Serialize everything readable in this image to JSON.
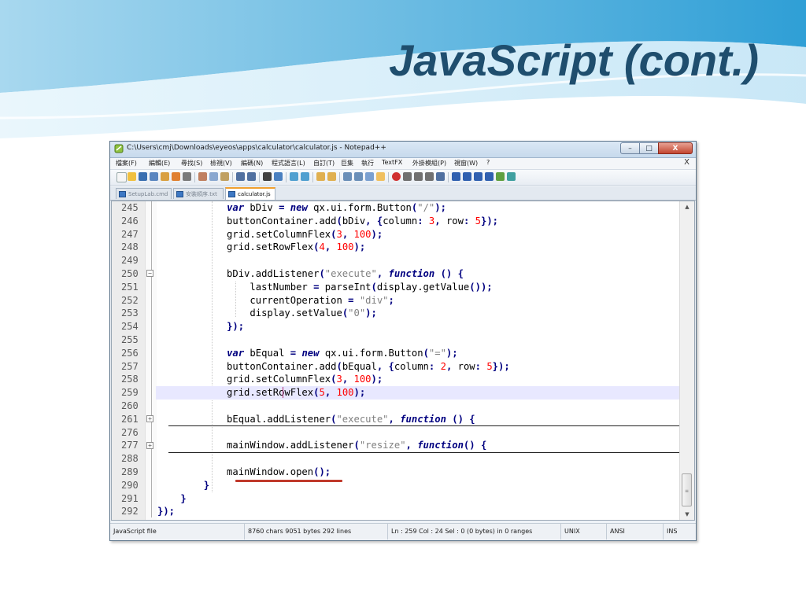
{
  "slide": {
    "title": "JavaScript (cont.)"
  },
  "window": {
    "title": "C:\\Users\\cmj\\Downloads\\eyeos\\apps\\calculator\\calculator.js - Notepad++",
    "min_symbol": "–",
    "max_symbol": "□",
    "close_symbol": "X"
  },
  "menu": {
    "items": [
      "檔案(F)",
      "編輯(E)",
      "尋找(S)",
      "檢視(V)",
      "編碼(N)",
      "程式語言(L)",
      "自訂(T)",
      "巨集",
      "執行",
      "TextFX",
      "外掛模組(P)",
      "視窗(W)",
      "?"
    ],
    "doc_close": "X"
  },
  "tabs": [
    {
      "label": "SetupLab.cmd",
      "active": false
    },
    {
      "label": "安裝順序.txt",
      "active": false
    },
    {
      "label": "calculator.js",
      "active": true
    }
  ],
  "code": {
    "lines": [
      {
        "n": "245",
        "text": "            var bDiv = new qx.ui.form.Button(\"/\");"
      },
      {
        "n": "246",
        "text": "            buttonContainer.add(bDiv, {column: 3, row: 5});"
      },
      {
        "n": "247",
        "text": "            grid.setColumnFlex(3, 100);"
      },
      {
        "n": "248",
        "text": "            grid.setRowFlex(4, 100);"
      },
      {
        "n": "249",
        "text": ""
      },
      {
        "n": "250",
        "text": "            bDiv.addListener(\"execute\", function () {"
      },
      {
        "n": "251",
        "text": "                lastNumber = parseInt(display.getValue());"
      },
      {
        "n": "252",
        "text": "                currentOperation = \"div\";"
      },
      {
        "n": "253",
        "text": "                display.setValue(\"0\");"
      },
      {
        "n": "254",
        "text": "            });"
      },
      {
        "n": "255",
        "text": ""
      },
      {
        "n": "256",
        "text": "            var bEqual = new qx.ui.form.Button(\"=\");"
      },
      {
        "n": "257",
        "text": "            buttonContainer.add(bEqual, {column: 2, row: 5});"
      },
      {
        "n": "258",
        "text": "            grid.setColumnFlex(3, 100);"
      },
      {
        "n": "259",
        "text": "            grid.setRowFlex(5, 100);"
      },
      {
        "n": "260",
        "text": ""
      },
      {
        "n": "261",
        "text": "            bEqual.addListener(\"execute\", function () {"
      },
      {
        "n": "276",
        "text": ""
      },
      {
        "n": "277",
        "text": "            mainWindow.addListener(\"resize\", function() {"
      },
      {
        "n": "288",
        "text": ""
      },
      {
        "n": "289",
        "text": "            mainWindow.open();"
      },
      {
        "n": "290",
        "text": "        }"
      },
      {
        "n": "291",
        "text": "    }"
      },
      {
        "n": "292",
        "text": "});"
      }
    ]
  },
  "status": {
    "file_type": "JavaScript file",
    "size": "8760 chars  9051 bytes  292 lines",
    "position": "Ln : 259   Col : 24   Sel : 0 (0 bytes) in 0 ranges",
    "eol": "UNIX",
    "encoding": "ANSI",
    "mode": "INS"
  },
  "colors": {
    "keyword": "#000080",
    "number": "#ff0000",
    "string": "#808080",
    "title": "#1f4e6e",
    "current_line": "#e8e8ff"
  }
}
